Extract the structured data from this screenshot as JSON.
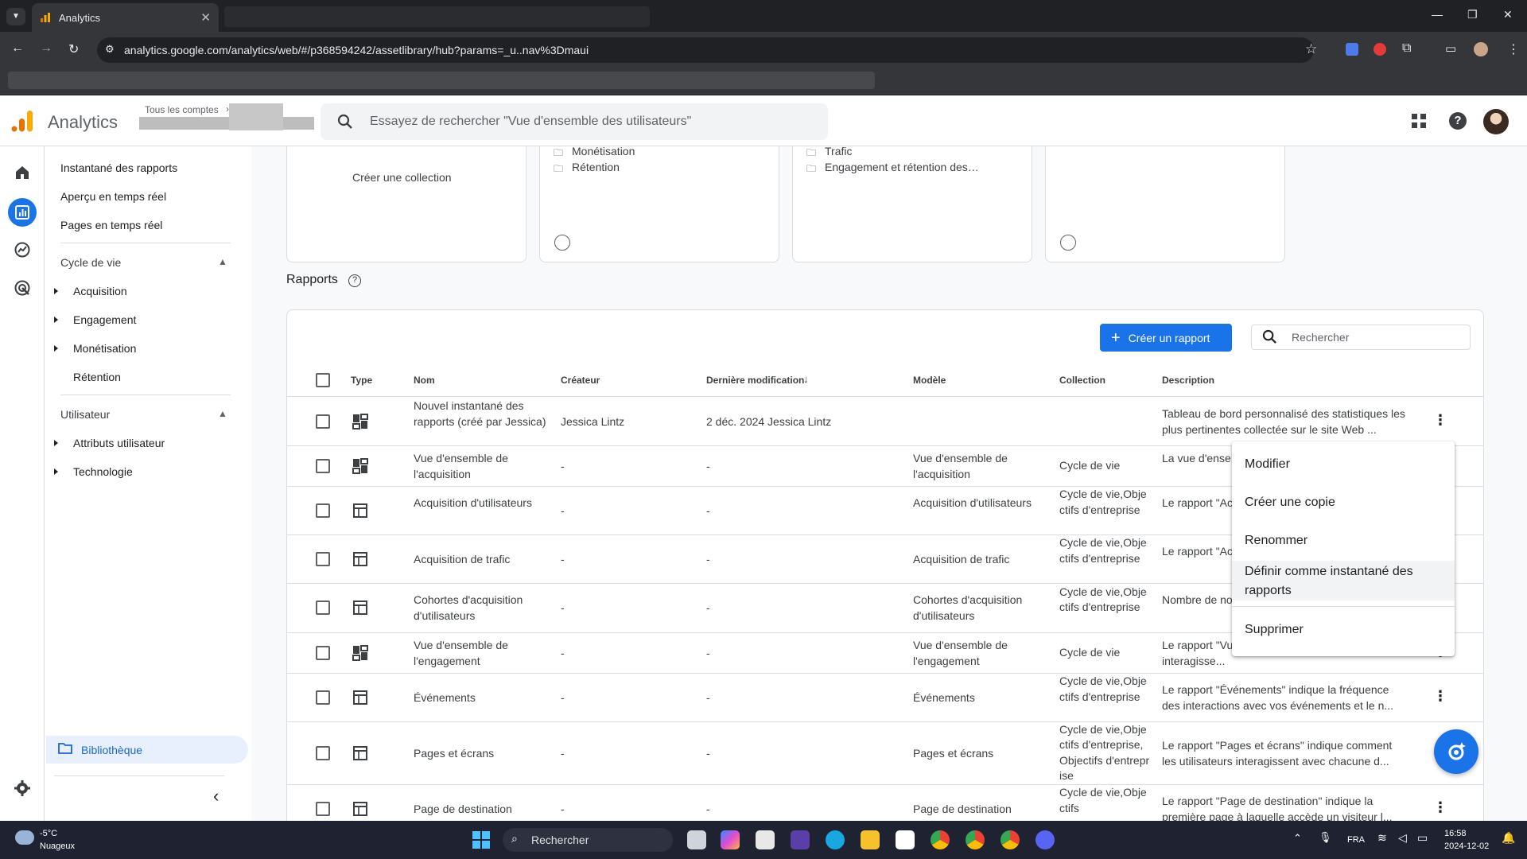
{
  "browser": {
    "tab_title": "Analytics",
    "url": "analytics.google.com/analytics/web/#/p368594242/assetlibrary/hub?params=_u..nav%3Dmaui"
  },
  "header": {
    "app_name": "Analytics",
    "account_label": "Tous les comptes",
    "search_placeholder": "Essayez de rechercher \"Vue d'ensemble des utilisateurs\""
  },
  "leftnav": {
    "top_items": [
      "Instantané des rapports",
      "Aperçu en temps réel",
      "Pages en temps réel"
    ],
    "section1": {
      "label": "Cycle de vie",
      "items": [
        "Acquisition",
        "Engagement",
        "Monétisation",
        "Rétention"
      ]
    },
    "section2": {
      "label": "Utilisateur",
      "items": [
        "Attributs utilisateur",
        "Technologie"
      ]
    },
    "library": "Bibliothèque"
  },
  "collections": {
    "create_label": "Créer une collection",
    "card2": [
      "Monétisation",
      "Rétention"
    ],
    "card3": [
      "Trafic",
      "Engagement et rétention des…"
    ]
  },
  "reports": {
    "title": "Rapports",
    "create_button": "Créer un rapport",
    "search_placeholder": "Rechercher",
    "columns": [
      "Type",
      "Nom",
      "Créateur",
      "Dernière modification",
      "Modèle",
      "Collection",
      "Description"
    ],
    "rows": [
      {
        "name": "Nouvel instantané des rapports (créé par Jessica)",
        "creator": "Jessica Lintz",
        "modified": "2 déc. 2024 Jessica Lintz",
        "model": "",
        "collection": "",
        "description": "Tableau de bord personnalisé des statistiques les plus pertinentes collectée sur le site Web ..."
      },
      {
        "name": "Vue d'ensemble de l'acquisition",
        "creator": "-",
        "modified": "-",
        "model": "Vue d'ensemble de l'acquisition",
        "collection": "Cycle de vie",
        "description": "La vue d'ense provenance de"
      },
      {
        "name": "Acquisition d'utilisateurs",
        "creator": "-",
        "modified": "-",
        "model": "Acquisition d'utilisateurs",
        "collection": "Cycle de vie,Objectifs d'entreprise",
        "description": "Le rapport \"Ac les données d"
      },
      {
        "name": "Acquisition de trafic",
        "creator": "-",
        "modified": "-",
        "model": "Acquisition de trafic",
        "collection": "Cycle de vie,Objectifs d'entreprise",
        "description": "Le rapport \"Ac provenance de"
      },
      {
        "name": "Cohortes d'acquisition d'utilisateurs",
        "creator": "-",
        "modified": "-",
        "model": "Cohortes d'acquisition d'utilisateurs",
        "collection": "Cycle de vie,Objectifs d'entreprise",
        "description": "Nombre de no transactions e"
      },
      {
        "name": "Vue d'ensemble de l'engagement",
        "creator": "-",
        "modified": "-",
        "model": "Vue d'ensemble de l'engagement",
        "collection": "Cycle de vie",
        "description": "Le rapport \"Vu indique comment les utilisateurs interagisse..."
      },
      {
        "name": "Événements",
        "creator": "-",
        "modified": "-",
        "model": "Événements",
        "collection": "Cycle de vie,Objectifs d'entreprise",
        "description": "Le rapport \"Événements\" indique la fréquence des interactions avec vos événements et le n..."
      },
      {
        "name": "Pages et écrans",
        "creator": "-",
        "modified": "-",
        "model": "Pages et écrans",
        "collection": "Cycle de vie,Objectifs d'entreprise,Objectifs d'entreprise",
        "description": "Le rapport \"Pages et écrans\" indique comment les utilisateurs interagissent avec chacune d..."
      },
      {
        "name": "Page de destination",
        "creator": "-",
        "modified": "-",
        "model": "Page de destination",
        "collection": "Cycle de vie,Objectifs",
        "description": "Le rapport \"Page de destination\" indique la première page à laquelle accède un visiteur l..."
      }
    ]
  },
  "context_menu": {
    "items": [
      "Modifier",
      "Créer une copie",
      "Renommer",
      "Définir comme instantané des rapports",
      "Supprimer"
    ]
  },
  "taskbar": {
    "weather_temp": "-5°C",
    "weather_desc": "Nuageux",
    "search": "Rechercher",
    "lang": "FRA",
    "time": "16:58",
    "date": "2024-12-02"
  },
  "colors": {
    "accent": "#1a73e8",
    "ga_orange": "#f9ab00",
    "ga_dark_orange": "#e37400"
  }
}
